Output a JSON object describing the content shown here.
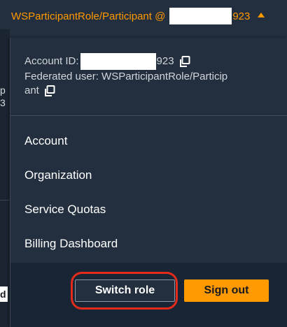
{
  "topbar": {
    "account_label": "WSParticipantRole/Participant @",
    "account_id_suffix": "923",
    "accent_color": "#ff9900",
    "caret_icon": "caret-up-icon"
  },
  "background_page": {
    "fragment_1": "p",
    "fragment_2": "3",
    "fragment_3": "d"
  },
  "account_info": {
    "account_id_label": "Account ID:",
    "account_id_suffix": "923",
    "federated_line_1": "Federated user: WSParticipantRole/Particip",
    "federated_line_2": "ant",
    "copy_icon": "copy-icon"
  },
  "menu": {
    "items": [
      {
        "label": "Account"
      },
      {
        "label": "Organization"
      },
      {
        "label": "Service Quotas"
      },
      {
        "label": "Billing Dashboard"
      }
    ]
  },
  "actions": {
    "switch_role_label": "Switch role",
    "sign_out_label": "Sign out",
    "highlight_color": "#e32b1c"
  }
}
